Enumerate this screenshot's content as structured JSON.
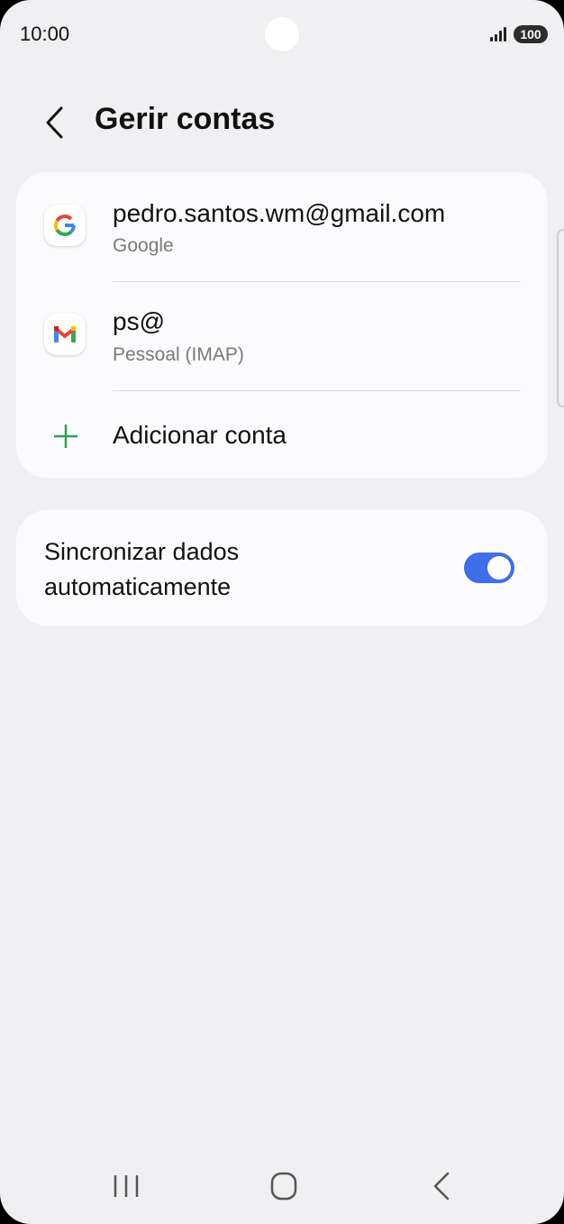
{
  "status_bar": {
    "time": "10:00",
    "battery": "100",
    "icons": [
      "signal-icon",
      "battery-icon"
    ]
  },
  "header": {
    "title": "Gerir contas",
    "back_icon": "back-arrow-icon"
  },
  "accounts": [
    {
      "title": "pedro.santos.wm@gmail.com",
      "subtitle": "Google",
      "icon": "google-icon"
    },
    {
      "title": "ps@",
      "subtitle": "Pessoal (IMAP)",
      "icon": "gmail-icon"
    }
  ],
  "add_account": {
    "label": "Adicionar conta",
    "icon": "plus-icon",
    "icon_color": "#2e9d56"
  },
  "sync": {
    "label": "Sincronizar dados automaticamente",
    "enabled": true,
    "accent_color": "#3e6ee8"
  },
  "nav_bar": {
    "icons": [
      "recent-apps-icon",
      "home-icon",
      "back-icon"
    ]
  }
}
